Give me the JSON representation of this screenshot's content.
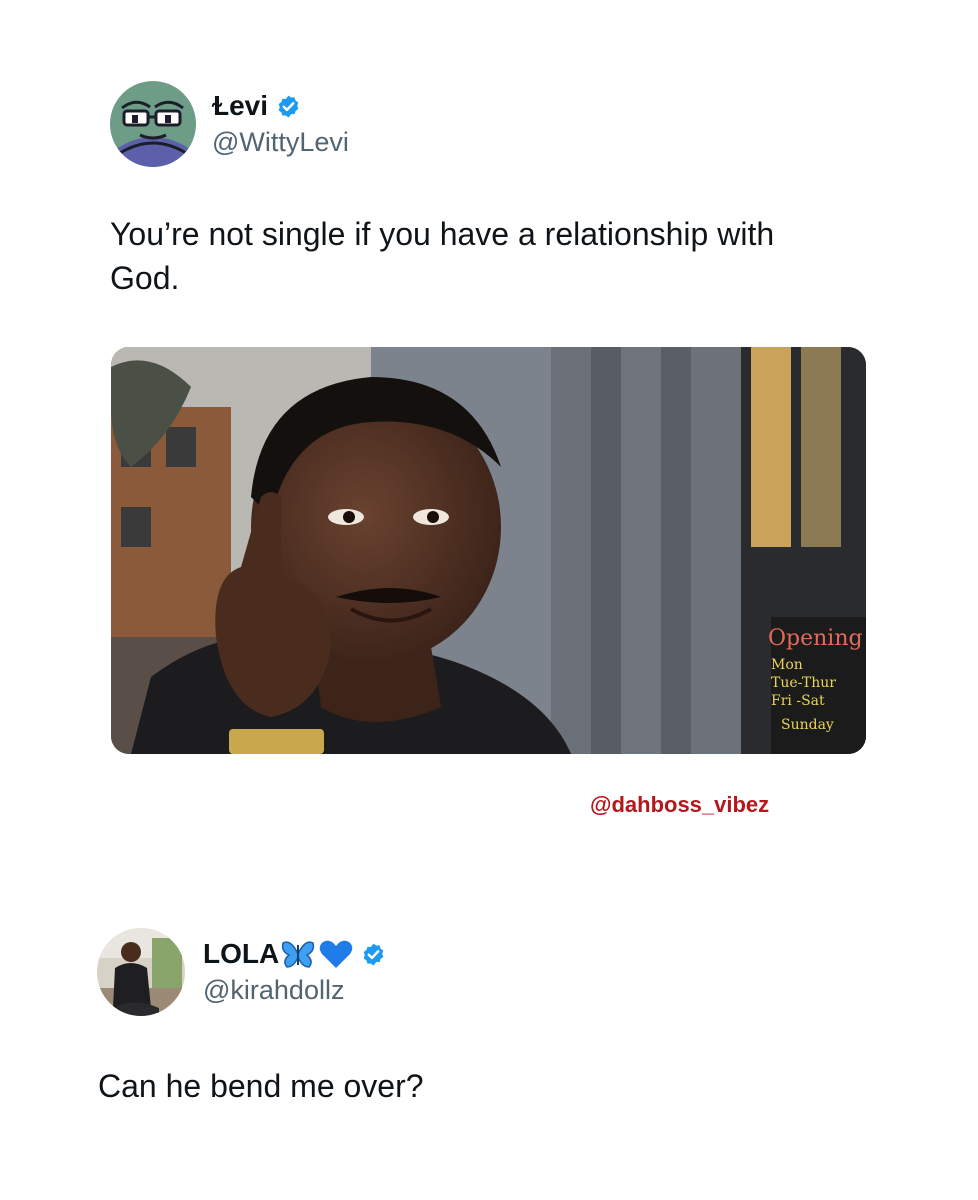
{
  "tweet1": {
    "display_name": "Ɫevi",
    "handle": "@WittyLevi",
    "verified": true,
    "text": "You’re not single if you have a relationship with God.",
    "avatar_icon": "cartoon-fish-face-icon",
    "image": {
      "description_icon": "man-tapping-head-meme-image",
      "sign_lines": [
        "Opening",
        "Mon",
        "Tue-Thur",
        "Fri -Sat",
        "Sunday"
      ]
    }
  },
  "watermark": "@dahboss_vibez",
  "tweet2": {
    "display_name": "LOLA",
    "handle": "@kirahdollz",
    "verified": true,
    "emojis": [
      "butterfly-emoji-icon",
      "blue-heart-emoji-icon"
    ],
    "text": "Can he bend me over?",
    "avatar_icon": "profile-photo-woman-icon"
  },
  "colors": {
    "verified_blue": "#1d9bf0",
    "handle_gray": "#536471",
    "watermark_red": "#b5171c",
    "text": "#0f1419"
  }
}
